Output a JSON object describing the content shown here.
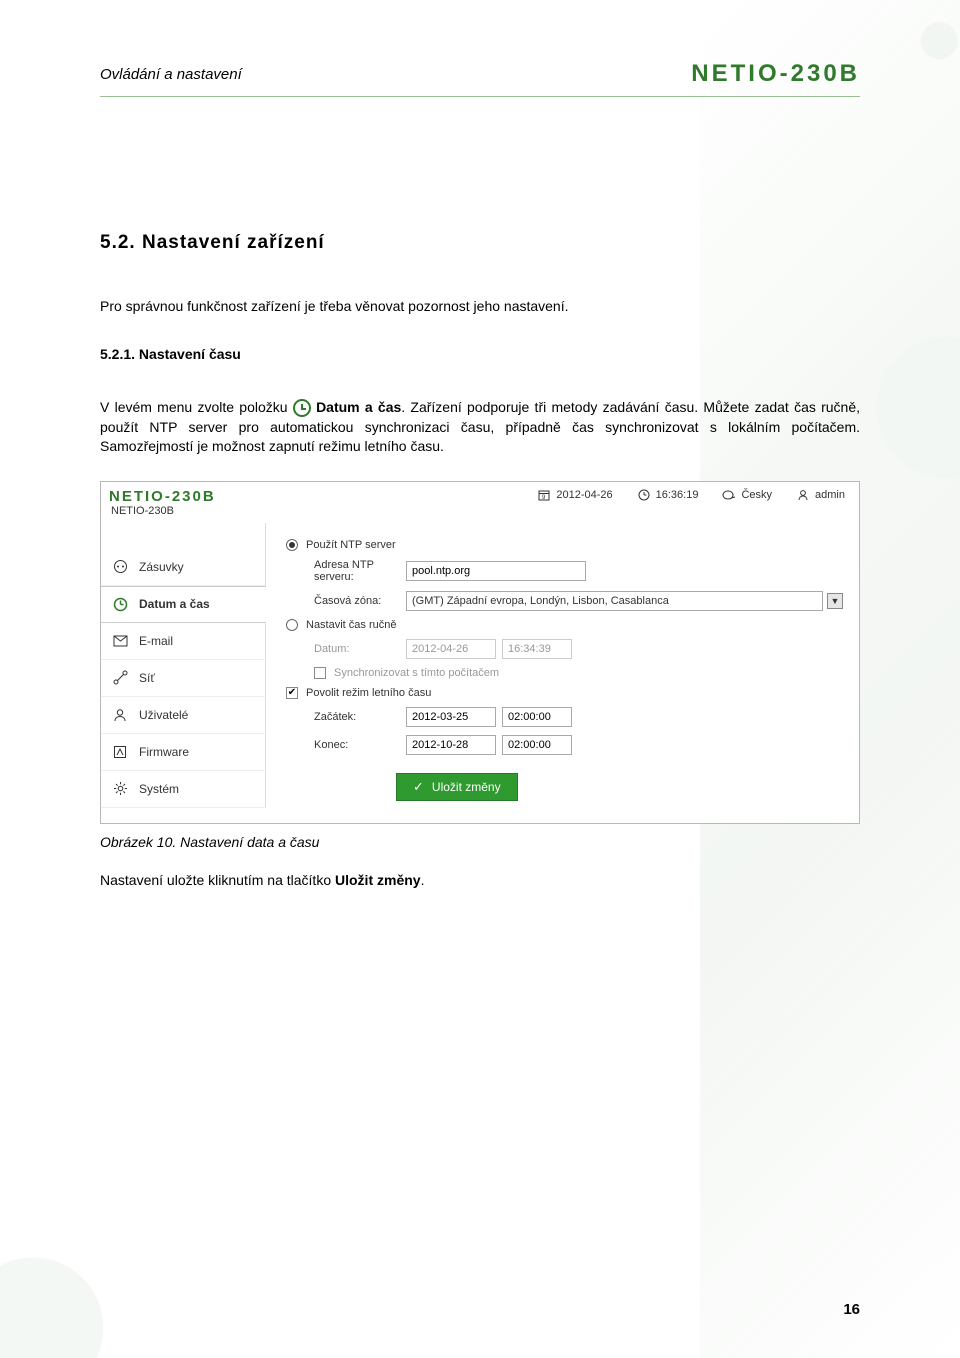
{
  "doc": {
    "section_header": "Ovládání a nastavení",
    "brand": "NETIO-230B",
    "h2": "5.2. Nastavení zařízení",
    "intro": "Pro správnou funkčnost zařízení je třeba věnovat pozornost jeho nastavení.",
    "h3": "5.2.1. Nastavení času",
    "body_pre": "V levém menu zvolte položku ",
    "body_bold": "Datum a čas",
    "body_post": ". Zařízení podporuje tři metody zadávání času. Můžete zadat čas ručně, použít NTP server pro automatickou synchronizaci času, případně čas synchronizovat s lokálním počítačem. Samozřejmostí je možnost zapnutí režimu letního času.",
    "caption": "Obrázek 10. Nastavení data a času",
    "after_caption_pre": "Nastavení uložte kliknutím na tlačítko ",
    "after_caption_bold": "Uložit změny",
    "after_caption_post": ".",
    "page_num": "16"
  },
  "ui": {
    "brand": "NETIO-230B",
    "sub_brand": "NETIO-230B",
    "topbar": {
      "date": "2012-04-26",
      "time": "16:36:19",
      "lang": "Česky",
      "user": "admin"
    },
    "nav": [
      {
        "icon": "outlet",
        "label": "Zásuvky",
        "selected": false
      },
      {
        "icon": "clock",
        "label": "Datum a čas",
        "selected": true
      },
      {
        "icon": "mail",
        "label": "E-mail",
        "selected": false
      },
      {
        "icon": "net",
        "label": "Síť",
        "selected": false
      },
      {
        "icon": "user",
        "label": "Uživatelé",
        "selected": false
      },
      {
        "icon": "fw",
        "label": "Firmware",
        "selected": false
      },
      {
        "icon": "gear",
        "label": "Systém",
        "selected": false
      }
    ],
    "form": {
      "use_ntp_label": "Použít NTP server",
      "ntp_addr_label": "Adresa NTP serveru:",
      "ntp_addr_value": "pool.ntp.org",
      "tz_label": "Časová zóna:",
      "tz_value": "(GMT) Západní evropa, Londýn, Lisbon, Casablanca",
      "manual_label": "Nastavit čas ručně",
      "date_label": "Datum:",
      "date_value": "2012-04-26",
      "time_value": "16:34:39",
      "sync_label": "Synchronizovat s tímto počítačem",
      "dst_label": "Povolit režim letního času",
      "dst_start_label": "Začátek:",
      "dst_start_date": "2012-03-25",
      "dst_start_time": "02:00:00",
      "dst_end_label": "Konec:",
      "dst_end_date": "2012-10-28",
      "dst_end_time": "02:00:00",
      "save_label": "Uložit změny"
    }
  }
}
